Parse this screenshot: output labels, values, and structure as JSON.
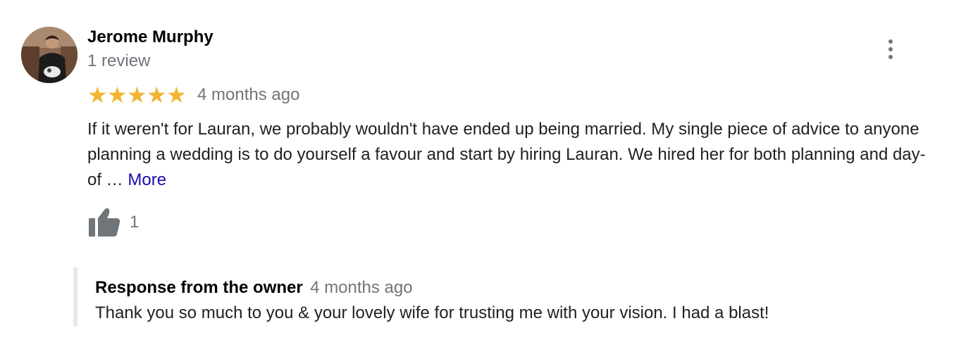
{
  "review": {
    "author_name": "Jerome Murphy",
    "author_review_count": "1 review",
    "rating": 5,
    "stars": [
      "★",
      "★",
      "★",
      "★",
      "★"
    ],
    "date": "4 months ago",
    "text": "If it weren't for Lauran, we probably wouldn't have ended up being married. My single piece of advice to anyone planning a wedding is to do yourself a favour and start by hiring Lauran. We hired her for both planning and day-of …",
    "more_label": "More",
    "like_count": "1"
  },
  "owner_response": {
    "title": "Response from the owner",
    "date": "4 months ago",
    "text": "Thank you so much to you & your lovely wife for trusting me with your vision. I had a blast!"
  },
  "icons": {
    "avatar": "profile-photo",
    "more_options": "vertical-dots-icon",
    "like": "thumbs-up-icon"
  },
  "colors": {
    "star": "#f2b431",
    "link": "#1a0dab",
    "secondary_text": "#70757a",
    "response_border": "#e8e8e8"
  }
}
